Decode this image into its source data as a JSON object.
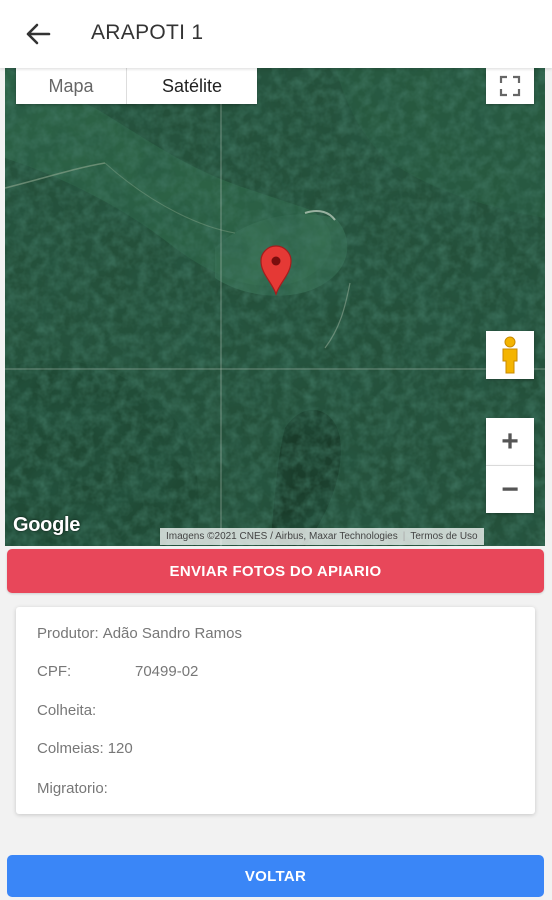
{
  "appbar": {
    "title": "ARAPOTI 1",
    "back_icon": "arrow-left-icon"
  },
  "map": {
    "map_type_options": [
      "Mapa",
      "Satélite"
    ],
    "selected_map_type": "Satélite",
    "logo": "Google",
    "attribution": "Imagens ©2021 CNES / Airbus, Maxar Technologies",
    "terms": "Termos de Uso",
    "zoom_in_label": "+",
    "zoom_out_label": "−",
    "marker_color": "#e53935"
  },
  "actions": {
    "send_photos_label": "ENVIAR FOTOS DO APIARIO",
    "back_label": "VOLTAR"
  },
  "details": {
    "produtor_label": "Produtor:",
    "produtor_value": "Adão Sandro Ramos",
    "cpf_label": "CPF:",
    "cpf_value": "70499-02",
    "colheita_label": "Colheita:",
    "colheita_value": "",
    "colmeias_label": "Colmeias:",
    "colmeias_value": "120",
    "migratorio_label": "Migratorio:",
    "migratorio_value": ""
  },
  "colors": {
    "send_button": "#e8475a",
    "back_button": "#3a86f7"
  }
}
